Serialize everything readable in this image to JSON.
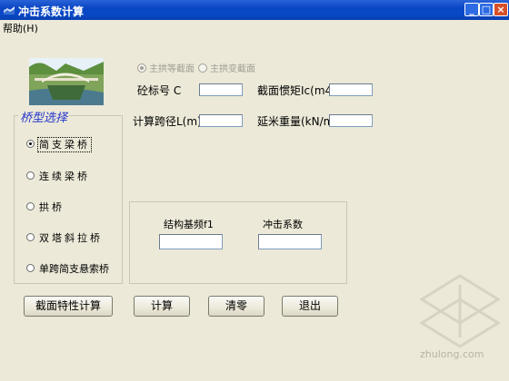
{
  "window": {
    "title": "冲击系数计算"
  },
  "menu": {
    "help": "帮助(H)"
  },
  "section_type": {
    "options": [
      "主拱等截面",
      "主拱变截面"
    ],
    "selected": 0
  },
  "inputs": {
    "concrete_grade_label": "砼标号 C",
    "inertia_label": "截面惯矩Ic(m4)",
    "span_label": "计算跨径L(m)",
    "weight_label": "延米重量(kN/m)",
    "concrete_grade_value": "",
    "inertia_value": "",
    "span_value": "",
    "weight_value": ""
  },
  "bridge_type": {
    "title": "桥型选择",
    "options": [
      "简支梁桥",
      "连续梁桥",
      "拱桥",
      "双塔斜拉桥",
      "单跨简支悬索桥"
    ],
    "selected": 0
  },
  "results": {
    "freq_label": "结构基频f1",
    "impact_label": "冲击系数",
    "freq_value": "",
    "impact_value": ""
  },
  "buttons": {
    "section_calc": "截面特性计算",
    "calc": "计算",
    "clear": "清零",
    "exit": "退出"
  },
  "watermark": {
    "text": "zhulong.com"
  }
}
